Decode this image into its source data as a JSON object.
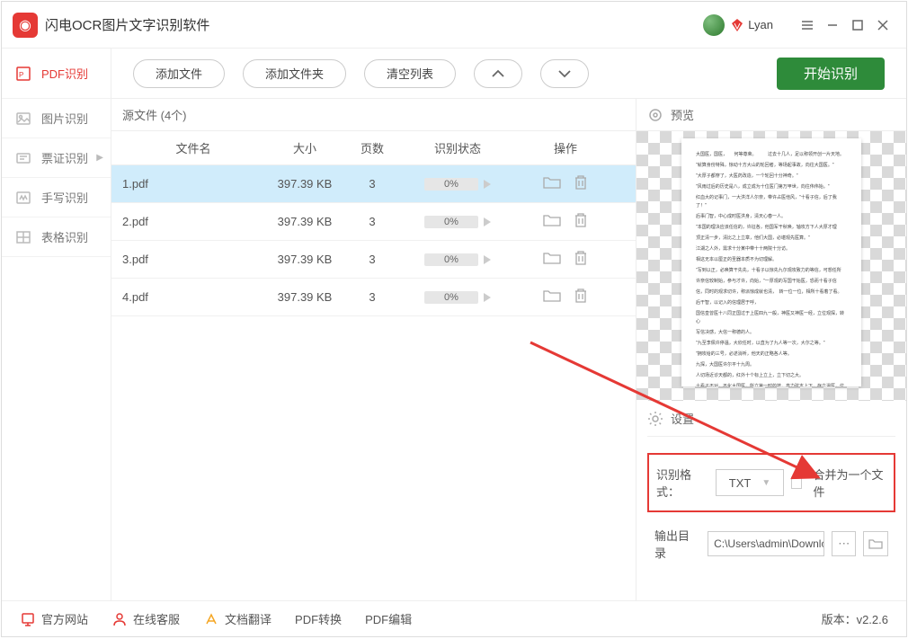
{
  "app": {
    "title": "闪电OCR图片文字识别软件",
    "username": "Lyan",
    "version_label": "版本：v2.2.6"
  },
  "sidebar": {
    "items": [
      {
        "label": "PDF识别"
      },
      {
        "label": "图片识别"
      },
      {
        "label": "票证识别"
      },
      {
        "label": "手写识别"
      },
      {
        "label": "表格识别"
      }
    ]
  },
  "toolbar": {
    "add_file": "添加文件",
    "add_folder": "添加文件夹",
    "clear_list": "清空列表",
    "start": "开始识别"
  },
  "filelist": {
    "count_label": "源文件 (4个)",
    "columns": {
      "name": "文件名",
      "size": "大小",
      "pages": "页数",
      "status": "识别状态",
      "ops": "操作"
    },
    "rows": [
      {
        "name": "1.pdf",
        "size": "397.39 KB",
        "pages": "3",
        "progress": "0%"
      },
      {
        "name": "2.pdf",
        "size": "397.39 KB",
        "pages": "3",
        "progress": "0%"
      },
      {
        "name": "3.pdf",
        "size": "397.39 KB",
        "pages": "3",
        "progress": "0%"
      },
      {
        "name": "4.pdf",
        "size": "397.39 KB",
        "pages": "3",
        "progress": "0%"
      }
    ]
  },
  "preview": {
    "title": "预览"
  },
  "settings": {
    "title": "设置",
    "format_label": "识别格式：",
    "format_value": "TXT",
    "merge_label": "合并为一个文件",
    "output_label": "输出目录",
    "output_path": "C:\\Users\\admin\\Downlo"
  },
  "footer": {
    "site": "官方网站",
    "support": "在线客服",
    "doctrans": "文档翻译",
    "pdfconv": "PDF转换",
    "pdfedit": "PDF编辑"
  }
}
